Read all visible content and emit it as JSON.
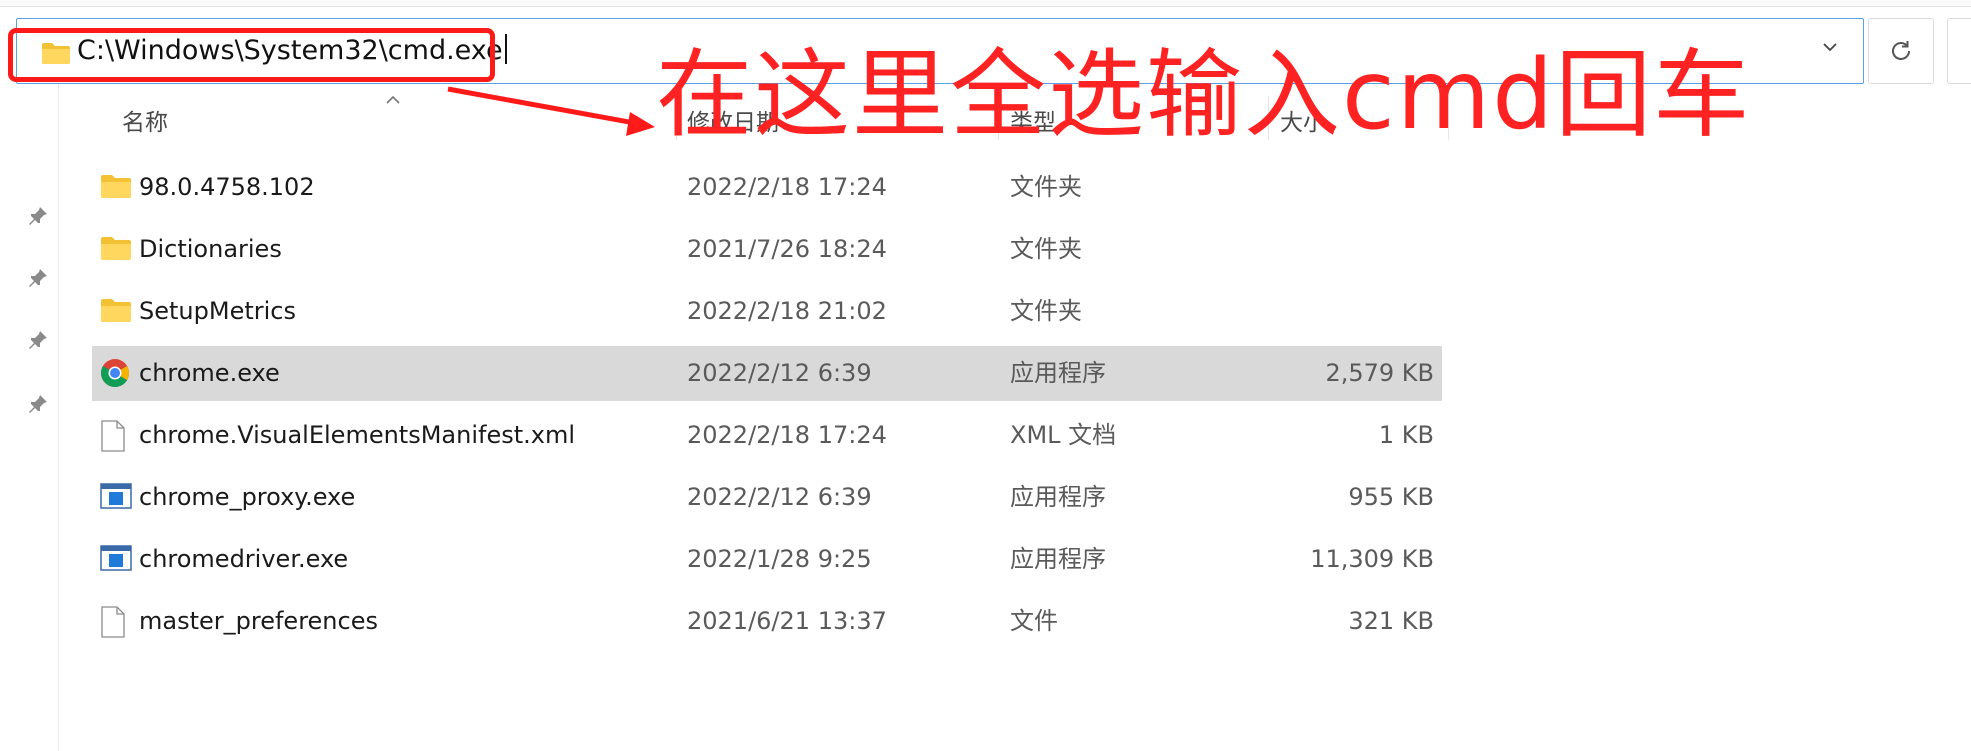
{
  "address_bar": {
    "path": "C:\\Windows\\System32\\cmd.exe"
  },
  "annotation": {
    "text": "在这里全选输入cmd回车",
    "color": "#ff2222"
  },
  "columns": {
    "name": "名称",
    "date": "修改日期",
    "type": "类型",
    "size": "大小"
  },
  "files": [
    {
      "name": "98.0.4758.102",
      "date": "2022/2/18 17:24",
      "type": "文件夹",
      "size": "",
      "icon": "folder-icon"
    },
    {
      "name": "Dictionaries",
      "date": "2021/7/26 18:24",
      "type": "文件夹",
      "size": "",
      "icon": "folder-icon"
    },
    {
      "name": "SetupMetrics",
      "date": "2022/2/18 21:02",
      "type": "文件夹",
      "size": "",
      "icon": "folder-icon"
    },
    {
      "name": "chrome.exe",
      "date": "2022/2/12 6:39",
      "type": "应用程序",
      "size": "2,579 KB",
      "icon": "chrome-icon"
    },
    {
      "name": "chrome.VisualElementsManifest.xml",
      "date": "2022/2/18 17:24",
      "type": "XML 文档",
      "size": "1 KB",
      "icon": "file-icon"
    },
    {
      "name": "chrome_proxy.exe",
      "date": "2022/2/12 6:39",
      "type": "应用程序",
      "size": "955 KB",
      "icon": "exe-icon"
    },
    {
      "name": "chromedriver.exe",
      "date": "2022/1/28 9:25",
      "type": "应用程序",
      "size": "11,309 KB",
      "icon": "exe-icon"
    },
    {
      "name": "master_preferences",
      "date": "2021/6/21 13:37",
      "type": "文件",
      "size": "321 KB",
      "icon": "file-icon"
    }
  ],
  "selected_row": 3,
  "colors": {
    "focus_border": "#5aa0e6",
    "selection": "#d9d9d9",
    "folder": "#f3c234"
  }
}
